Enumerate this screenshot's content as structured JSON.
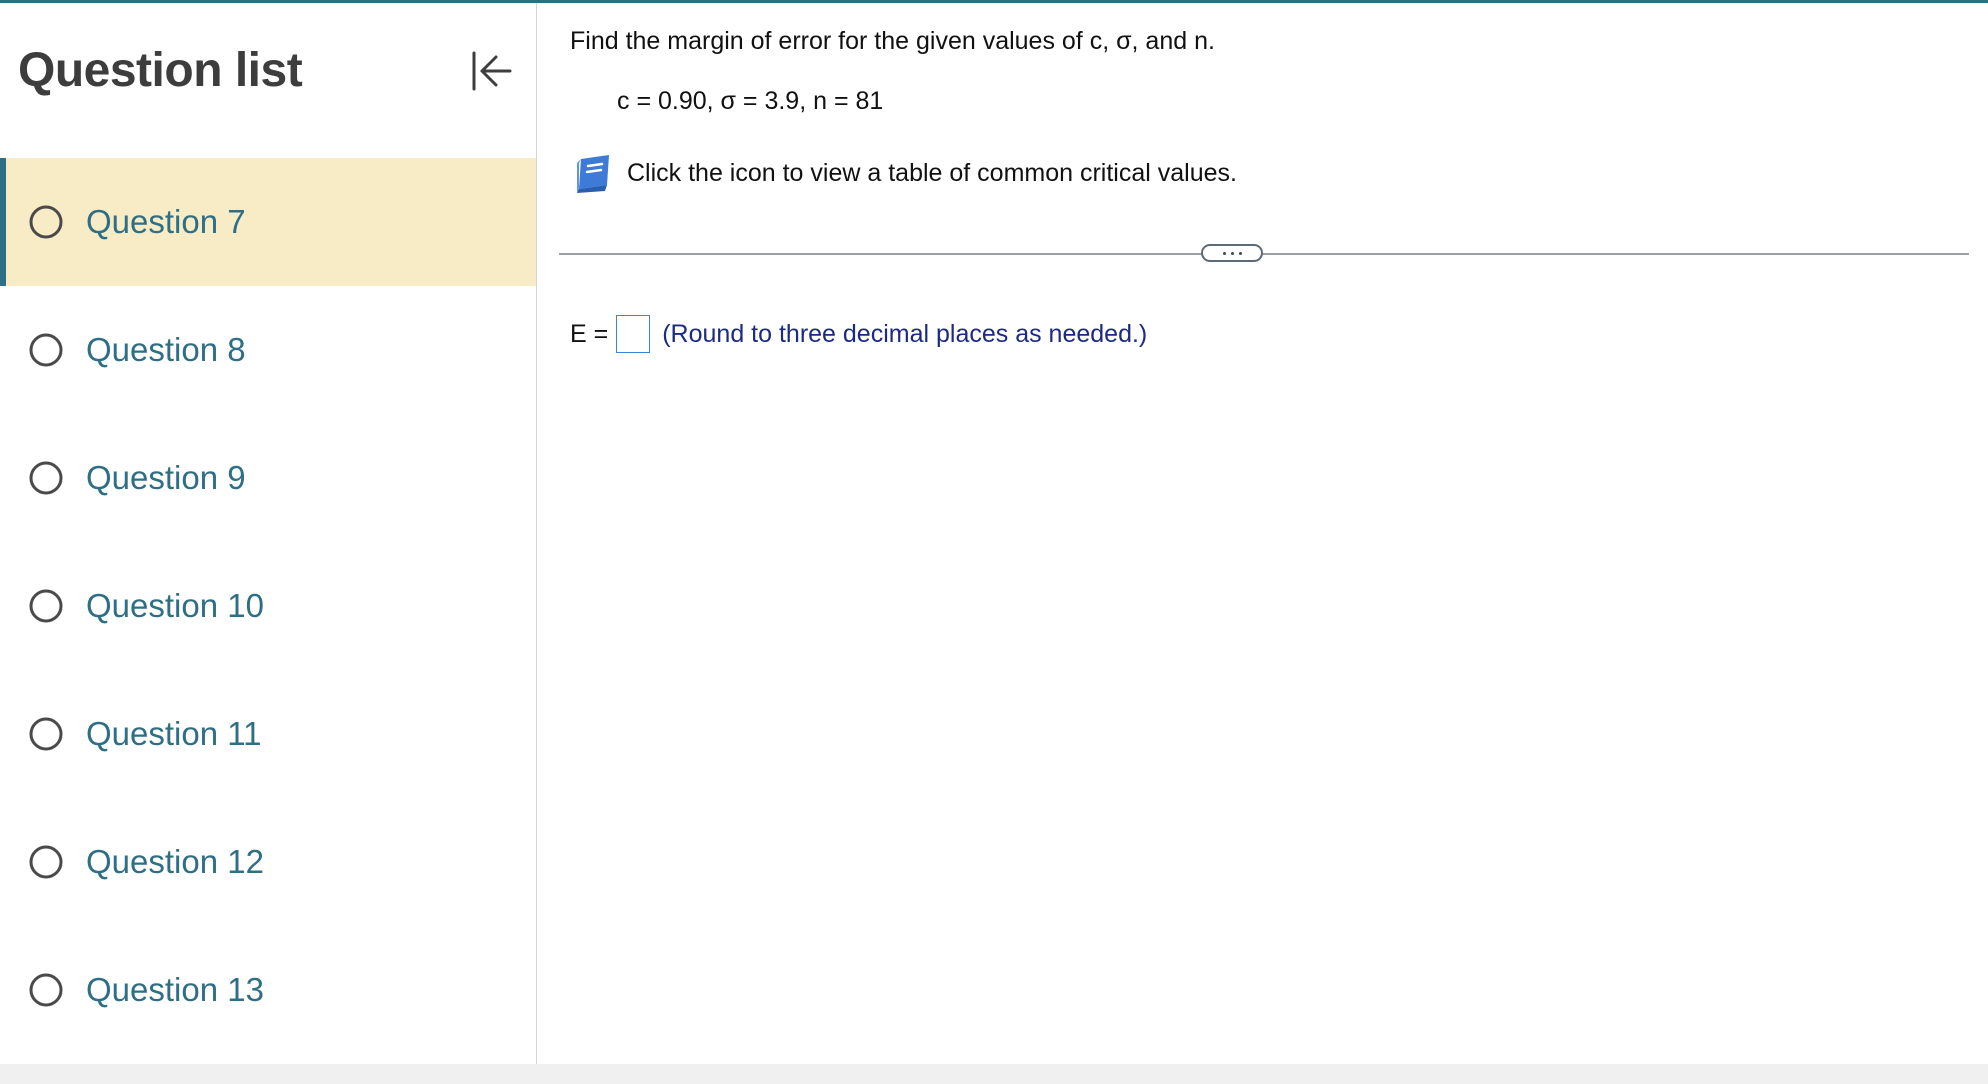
{
  "sidebar": {
    "title": "Question list",
    "collapse_icon": "collapse-left-icon",
    "questions": [
      {
        "label": "Question 7",
        "active": true
      },
      {
        "label": "Question 8",
        "active": false
      },
      {
        "label": "Question 9",
        "active": false
      },
      {
        "label": "Question 10",
        "active": false
      },
      {
        "label": "Question 11",
        "active": false
      },
      {
        "label": "Question 12",
        "active": false
      },
      {
        "label": "Question 13",
        "active": false
      }
    ]
  },
  "main": {
    "prompt": "Find the margin of error for the given values of c, σ, and n.",
    "params": "c = 0.90, σ = 3.9, n = 81",
    "table_link": {
      "icon": "book-icon",
      "text": "Click the icon to view a table of common critical values."
    },
    "expand_icon": "more-dots-icon",
    "answer": {
      "label": "E =",
      "value": "",
      "hint": "(Round to three decimal places as needed.)"
    }
  },
  "colors": {
    "accent": "#2f6f86",
    "active_background": "#f8ecc6",
    "hint_text": "#1c2a80",
    "input_border": "#3a85d6",
    "book_icon": "#3d7bd6"
  }
}
